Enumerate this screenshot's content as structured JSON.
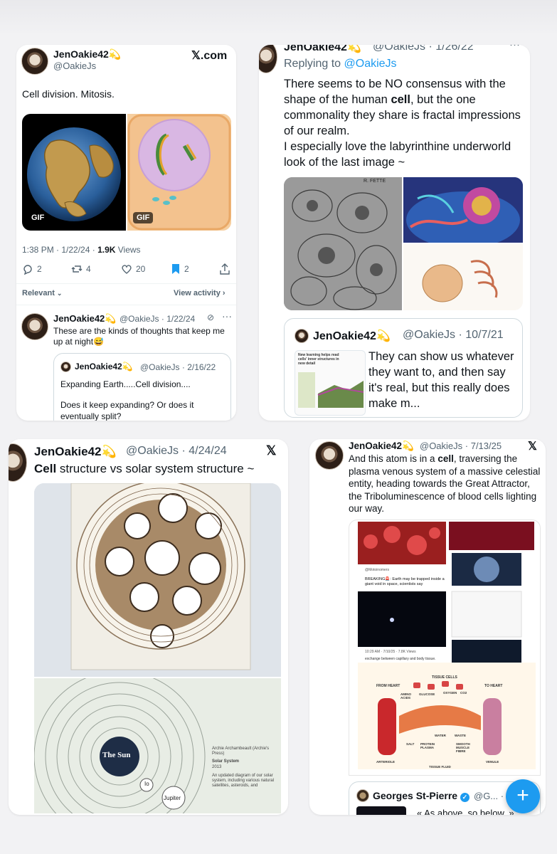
{
  "c1": {
    "name": "JenOakie42",
    "handle": "@OakieJs",
    "brand": "𝕏.com",
    "text": "Cell division. Mitosis.",
    "gif1": "GIF",
    "gif2": "GIF",
    "time": "1:38 PM · 1/22/24 · ",
    "views_num": "1.9K",
    "views_label": " Views",
    "replies": "2",
    "reposts": "4",
    "likes": "20",
    "bookmarks": "2",
    "relevant": "Relevant",
    "view_activity": "View activity",
    "reply": {
      "name": "JenOakie42",
      "meta": "@OakieJs · 1/22/24",
      "text": "These are the kinds of thoughts that keep me up at night😅"
    },
    "quote": {
      "name": "JenOakie42",
      "meta": "@OakieJs · 2/16/22",
      "text1": "Expanding Earth.....Cell division....",
      "text2": "Does it keep expanding? Or does it eventually split?"
    }
  },
  "c2": {
    "name": "JenOakie42",
    "meta": "@OakieJs · 1/26/22",
    "replying_prefix": "Replying to ",
    "replying_handle": "@OakieJs",
    "text_a": "There seems to be NO consensus with the shape of the human ",
    "text_bold": "cell",
    "text_b": ", but the one commonality they share is fractal impressions of our realm.",
    "text_c": "I especially love the labyrinthine underworld look of the last image ~",
    "img_label": "R. FETTE",
    "quote": {
      "name": "JenOakie42",
      "meta": "@OakieJs · 10/7/21",
      "text": "They can show us whatever they want to, and then say it's real, but this really does make m...",
      "thumb_title": "New learning helps read cells' inner structures in new detail"
    }
  },
  "c3": {
    "name": "JenOakie42",
    "meta": "@OakieJs · 4/24/24",
    "text_bold": "Cell",
    "text_rest": " structure vs solar system structure ~",
    "sun_label": "The Sun",
    "planet_io": "Io",
    "planet_jupiter": "Jupiter",
    "caption1": "Archie Archambeault (Archie's Press)",
    "caption2": "Solar System",
    "caption3": "2013",
    "caption4": "An updated diagram of our solar system, including various natural satellites, asteroids, and"
  },
  "c4": {
    "name": "JenOakie42",
    "meta": "@OakieJs · 7/13/25",
    "text_a": "And this atom is in a ",
    "text_bold": "cell",
    "text_b": ", traversing the plasma venous system of a massive celestial entity, heading towards the Great Attractor, the Triboluminescence of blood cells lighting our way.",
    "inner_handle": "@Motoinomers",
    "breaking": "BREAKING🚨: Earth may be trapped inside a giant void in space, scientists say",
    "inner_time": "10:29 AM · 7/10/25 · 7.8K Views",
    "diagram_title": "exchange between capillary and body tissue.",
    "labels": [
      "FROM HEART",
      "TISSUE CELLS",
      "TO HEART",
      "AMINO ACIDS",
      "GLUCOSE",
      "OXYGEN",
      "CO2",
      "WATER",
      "WASTE",
      "SALT",
      "PROTEIN PLASMA",
      "SMOOTH MUSCLE FIBRE",
      "ARTERIOLE",
      "TISSUE FLUID",
      "VENULE"
    ],
    "reply_name": "Georges St-Pierre",
    "reply_meta": "@G... · 7/",
    "reply_text": "« As above, so below. »"
  },
  "colors": {
    "accent": "#1d9bf0",
    "text": "#0f1419",
    "muted": "#536471"
  }
}
